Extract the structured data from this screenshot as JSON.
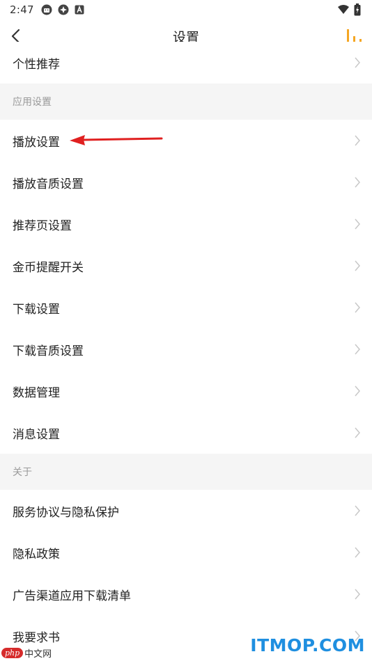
{
  "status_bar": {
    "time": "2:47",
    "left_icons": [
      "android-robot-icon",
      "settings-sync-icon",
      "a-square-icon"
    ],
    "right_icons": [
      "wifi-icon",
      "battery-charging-icon"
    ]
  },
  "header": {
    "title": "设置",
    "back_icon": "chevron-left-icon",
    "right_icon": "equalizer-icon",
    "accent_color": "#f5a623"
  },
  "list": {
    "top_item": {
      "label": "个性推荐"
    },
    "sections": [
      {
        "title": "应用设置",
        "items": [
          {
            "label": "播放设置"
          },
          {
            "label": "播放音质设置"
          },
          {
            "label": "推荐页设置"
          },
          {
            "label": "金币提醒开关"
          },
          {
            "label": "下载设置"
          },
          {
            "label": "下载音质设置"
          },
          {
            "label": "数据管理"
          },
          {
            "label": "消息设置"
          }
        ]
      },
      {
        "title": "关于",
        "items": [
          {
            "label": "服务协议与隐私保护"
          },
          {
            "label": "隐私政策"
          },
          {
            "label": "广告渠道应用下载清单"
          },
          {
            "label": "我要求书"
          }
        ]
      }
    ]
  },
  "annotation": {
    "arrow_color": "#e02020",
    "points_to": "播放设置"
  },
  "watermarks": {
    "left_badge": "php",
    "left_text": "中文网",
    "right_text": "ITMOP.COM",
    "right_color": "#1f8fe0"
  }
}
